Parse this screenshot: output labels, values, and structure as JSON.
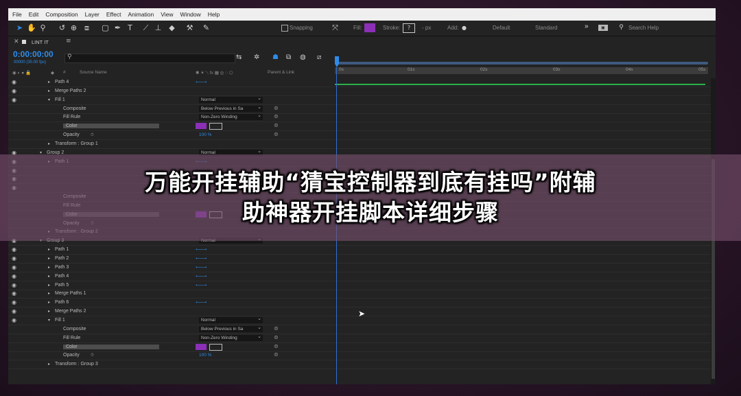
{
  "menu": [
    "File",
    "Edit",
    "Composition",
    "Layer",
    "Effect",
    "Animation",
    "View",
    "Window",
    "Help"
  ],
  "toolbar": {
    "snapping": "Snapping",
    "fill_label": "Fill:",
    "stroke_label": "Stroke:",
    "stroke_value": "?",
    "px": "- px",
    "add": "Add:",
    "workspaces": [
      "Default",
      "Standard"
    ],
    "more": "»",
    "search_help": "Search Help",
    "fill_color": "#8b2fb7",
    "accent": "#2d8ceb"
  },
  "comp": {
    "tab_name": "LINT IT",
    "timecode": "0:00:00:00",
    "fps": "00000 (30.00 fps)",
    "search_placeholder": "",
    "col_source_name": "Source Name",
    "col_parent": "Parent & Link",
    "col_hash": "#"
  },
  "ruler": [
    "0s",
    "01s",
    "02s",
    "03s",
    "04s",
    "05s"
  ],
  "layers": [
    {
      "name": "Path 4",
      "indent": 3,
      "eye": true,
      "twirl": "▸",
      "type": "path"
    },
    {
      "name": "Merge Paths 2",
      "indent": 3,
      "eye": true,
      "twirl": "▸",
      "type": "plain"
    },
    {
      "name": "Fill 1",
      "indent": 3,
      "eye": true,
      "twirl": "▾",
      "type": "select",
      "value": "Normal"
    },
    {
      "name": "Composite",
      "indent": 4,
      "eye": false,
      "twirl": "",
      "type": "select",
      "value": "Below Previous in Sa"
    },
    {
      "name": "Fill Rule",
      "indent": 4,
      "eye": false,
      "twirl": "",
      "type": "select",
      "value": "Non-Zero Winding"
    },
    {
      "name": "Color",
      "indent": 4,
      "eye": false,
      "twirl": "",
      "type": "color",
      "stopwatch": true
    },
    {
      "name": "Opacity",
      "indent": 4,
      "eye": false,
      "twirl": "",
      "type": "value",
      "value": "100 %",
      "stopwatch": true
    },
    {
      "name": "Transform : Group 1",
      "indent": 3,
      "eye": false,
      "twirl": "▸",
      "type": "plain"
    },
    {
      "name": "Group 2",
      "indent": 2,
      "eye": true,
      "twirl": "▾",
      "type": "select",
      "value": "Normal"
    },
    {
      "name": "Path 1",
      "indent": 3,
      "eye": true,
      "twirl": "▸",
      "type": "path"
    },
    {
      "name": "",
      "indent": 3,
      "eye": true,
      "twirl": "",
      "type": "plain"
    },
    {
      "name": "",
      "indent": 3,
      "eye": true,
      "twirl": "",
      "type": "plain"
    },
    {
      "name": "",
      "indent": 3,
      "eye": true,
      "twirl": "",
      "type": "plain"
    },
    {
      "name": "Composite",
      "indent": 4,
      "eye": false,
      "twirl": "",
      "type": "plain"
    },
    {
      "name": "Fill Rule",
      "indent": 4,
      "eye": false,
      "twirl": "",
      "type": "plain"
    },
    {
      "name": "Color",
      "indent": 4,
      "eye": false,
      "twirl": "",
      "type": "color",
      "stopwatch": true
    },
    {
      "name": "Opacity",
      "indent": 4,
      "eye": false,
      "twirl": "",
      "type": "plain",
      "stopwatch": true
    },
    {
      "name": "Transform : Group 2",
      "indent": 3,
      "eye": false,
      "twirl": "▸",
      "type": "plain"
    },
    {
      "name": "Group 3",
      "indent": 2,
      "eye": true,
      "twirl": "▾",
      "type": "select",
      "value": "Normal"
    },
    {
      "name": "Path 1",
      "indent": 3,
      "eye": true,
      "twirl": "▸",
      "type": "path"
    },
    {
      "name": "Path 2",
      "indent": 3,
      "eye": true,
      "twirl": "▸",
      "type": "path"
    },
    {
      "name": "Path 3",
      "indent": 3,
      "eye": true,
      "twirl": "▸",
      "type": "path"
    },
    {
      "name": "Path 4",
      "indent": 3,
      "eye": true,
      "twirl": "▸",
      "type": "path"
    },
    {
      "name": "Path 5",
      "indent": 3,
      "eye": true,
      "twirl": "▸",
      "type": "path"
    },
    {
      "name": "Merge Paths 1",
      "indent": 3,
      "eye": true,
      "twirl": "▸",
      "type": "plain"
    },
    {
      "name": "Path 6",
      "indent": 3,
      "eye": true,
      "twirl": "▸",
      "type": "path"
    },
    {
      "name": "Merge Paths 2",
      "indent": 3,
      "eye": true,
      "twirl": "▸",
      "type": "plain"
    },
    {
      "name": "Fill 1",
      "indent": 3,
      "eye": true,
      "twirl": "▾",
      "type": "select",
      "value": "Normal"
    },
    {
      "name": "Composite",
      "indent": 4,
      "eye": false,
      "twirl": "",
      "type": "select",
      "value": "Below Previous in Sa"
    },
    {
      "name": "Fill Rule",
      "indent": 4,
      "eye": false,
      "twirl": "",
      "type": "select",
      "value": "Non-Zero Winding"
    },
    {
      "name": "Color",
      "indent": 4,
      "eye": false,
      "twirl": "",
      "type": "color",
      "stopwatch": true
    },
    {
      "name": "Opacity",
      "indent": 4,
      "eye": false,
      "twirl": "",
      "type": "value",
      "value": "100 %",
      "stopwatch": true
    },
    {
      "name": "Transform : Group 3",
      "indent": 3,
      "eye": false,
      "twirl": "▸",
      "type": "plain"
    }
  ],
  "overlay": {
    "line1": "万能开挂辅助“猜宝控制器到底有挂吗”附辅",
    "line2": "助神器开挂脚本详细步骤"
  }
}
